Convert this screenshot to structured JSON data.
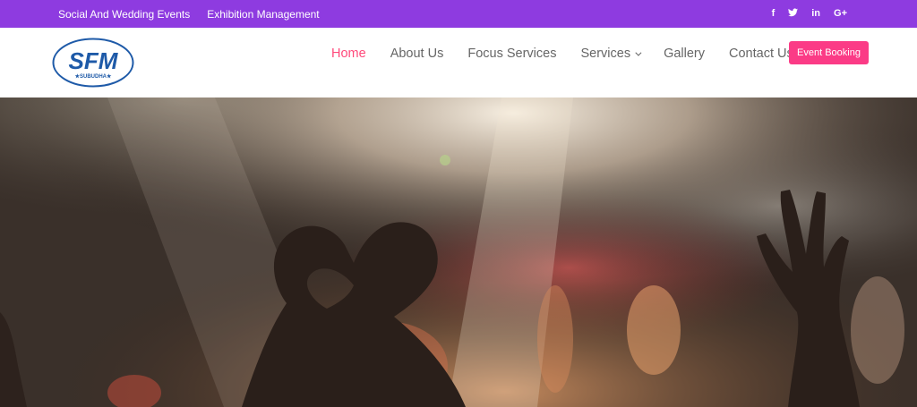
{
  "topbar": {
    "links": [
      "Social And Wedding Events",
      "Exhibition Management"
    ],
    "social": [
      {
        "icon": "facebook-icon",
        "glyph": "f"
      },
      {
        "icon": "twitter-icon",
        "glyph": "t"
      },
      {
        "icon": "linkedin-icon",
        "glyph": "in"
      },
      {
        "icon": "google-plus-icon",
        "glyph": "G+"
      }
    ]
  },
  "logo": {
    "main": "SFM",
    "sub": "★SUBUDHA★"
  },
  "nav": {
    "items": [
      "Home",
      "About Us",
      "Focus Services",
      "Services",
      "Gallery",
      "Contact Us"
    ],
    "active": "Home"
  },
  "booking_button": "Event Booking",
  "hero": {
    "image": "concert-crowd-heart-hands"
  },
  "colors": {
    "topbar": "#8e3be0",
    "accent": "#ff4a7b",
    "button": "#fb3b86",
    "logo": "#1e5aa8"
  }
}
